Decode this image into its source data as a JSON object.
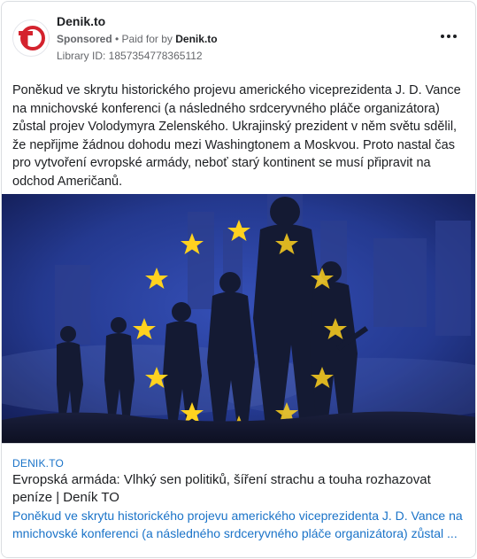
{
  "header": {
    "page_name": "Denik.to",
    "sponsored": "Sponsored",
    "separator": " • ",
    "paid_for_by": "Paid for by",
    "payer": "Denik.to",
    "library_id": "Library ID: 1857354778365112",
    "logo_text": "TO"
  },
  "post": {
    "body": "Poněkud ve skrytu historického projevu amerického viceprezidenta J. D. Vance na mnichovské konferenci (a následného srdceryvného pláče organizátora) zůstal projev Volodymyra Zelenského. Ukrajinský prezident v něm světu sdělil, že nepřijme žádnou dohodu mezi Washingtonem a Moskvou. Proto nastal čas pro vytvoření evropské armády, neboť starý kontinent se musí připravit na odchod Američanů."
  },
  "link": {
    "domain": "DENIK.TO",
    "title": "Evropská armáda: Vlhký sen politiků, šíření strachu a touha rozhazovat peníze | Deník TO",
    "description": "Poněkud ve skrytu historického projevu amerického viceprezidenta J. D. Vance na mnichovské konferenci (a následného srdceryvného pláče organizátora) zůstal ..."
  },
  "colors": {
    "brand_red": "#d4232e",
    "link_blue": "#1a73c8",
    "eu_blue": "#1f3a93",
    "eu_star": "#ffd21f"
  },
  "icons": {
    "more": "three-dots-icon",
    "flag": "eu-flag-stars"
  }
}
